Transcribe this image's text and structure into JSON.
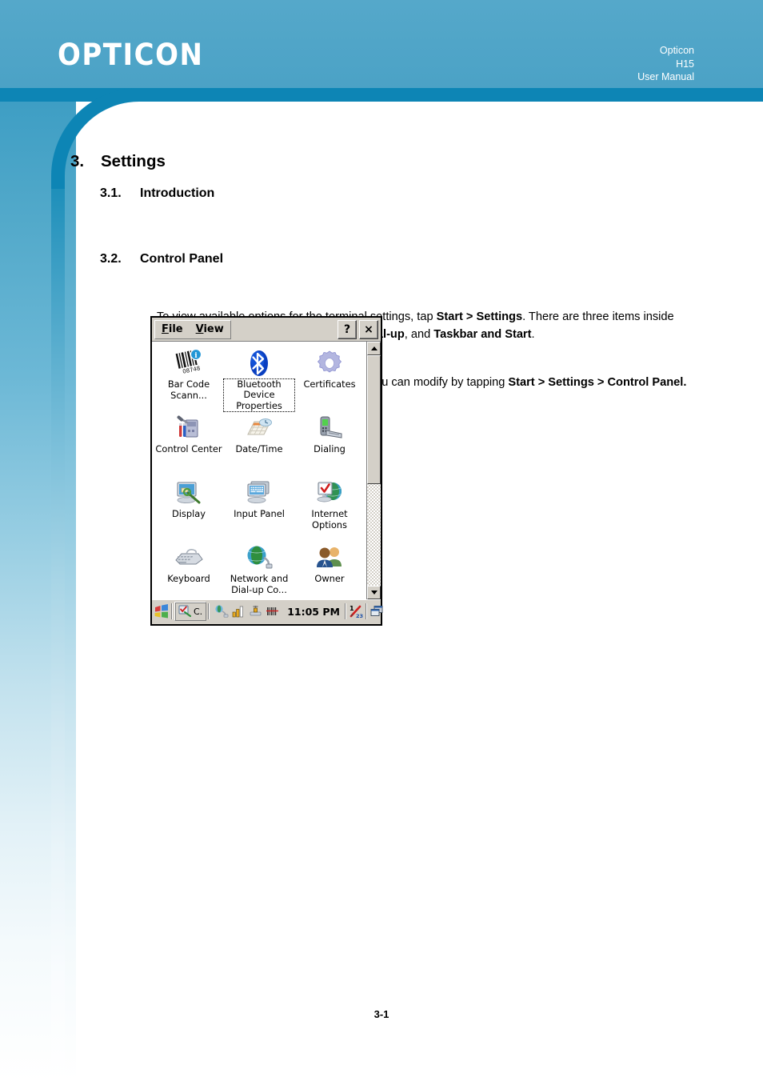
{
  "header": {
    "logo": "OPTICON",
    "meta_line1": "Opticon",
    "meta_line2": "H15",
    "meta_line3": "User Manual",
    "band_color": "#4ba3c7",
    "rule_color": "#0d85b5"
  },
  "document": {
    "section_number": "3.",
    "section_title": "Settings",
    "sub1_number": "3.1.",
    "sub1_title": "Introduction",
    "sub1_body_html": "To view available options for the terminal settings, tap <b>Start &gt; Settings</b>. There are three items inside <b>Settings</b>: <b>Control Panel</b>, <b>Network and Dial-up</b>, and <b>Taskbar and Start</b>.",
    "sub2_number": "3.2.",
    "sub2_title": "Control Panel",
    "sub2_body_html": "View the <b>Control Panel</b> and the settings you can modify by tapping <b>Start &gt; Settings &gt; Control Panel.</b>",
    "page_number": "3-1"
  },
  "screenshot": {
    "menubar": {
      "file": "File",
      "file_accel": "F",
      "view": "View",
      "view_accel": "V",
      "help_button": "?",
      "close_button": "×"
    },
    "icons": [
      {
        "label": "Bar Code Scann...",
        "icon": "barcode-scanner-icon",
        "selected": false
      },
      {
        "label": "Bluetooth Device Properties",
        "icon": "bluetooth-icon",
        "selected": true
      },
      {
        "label": "Certificates",
        "icon": "certificates-gear-icon",
        "selected": false
      },
      {
        "label": "Control Center",
        "icon": "control-center-tools-icon",
        "selected": false
      },
      {
        "label": "Date/Time",
        "icon": "date-time-calendar-icon",
        "selected": false
      },
      {
        "label": "Dialing",
        "icon": "dialing-phone-icon",
        "selected": false
      },
      {
        "label": "Display",
        "icon": "display-monitor-icon",
        "selected": false
      },
      {
        "label": "Input Panel",
        "icon": "input-panel-keyboard-icon",
        "selected": false
      },
      {
        "label": "Internet Options",
        "icon": "internet-options-globe-icon",
        "selected": false
      },
      {
        "label": "Keyboard",
        "icon": "keyboard-icon",
        "selected": false
      },
      {
        "label": "Network and Dial-up Co...",
        "icon": "network-dialup-globe-icon",
        "selected": false
      },
      {
        "label": "Owner",
        "icon": "owner-people-icon",
        "selected": false
      }
    ],
    "scrollbar": {
      "up_arrow": "scroll-up-icon",
      "down_arrow": "scroll-down-icon",
      "thumb_fraction_percent": 56
    },
    "taskbar": {
      "start_button": "start-flag-icon",
      "task_label": "C.",
      "task_icon": "control-panel-task-icon",
      "tray_icons": [
        "desktop-globe-icon",
        "signal-bars-icon",
        "connection-icon",
        "barcode-tray-icon"
      ],
      "time": "11:05 PM",
      "right_icons": [
        "stylus-pen-icon",
        "windows-cascade-icon"
      ]
    },
    "window_chrome_color": "#d4d0c8"
  }
}
